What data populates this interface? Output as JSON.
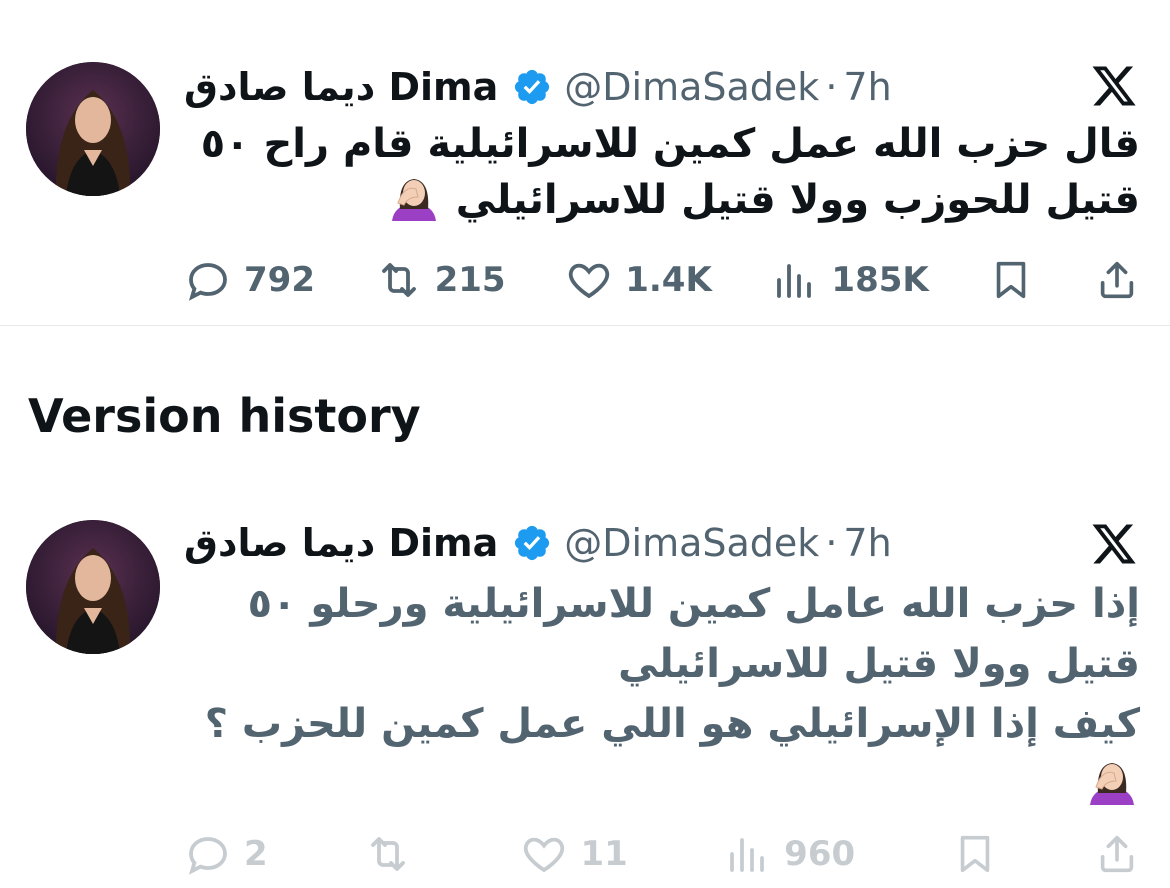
{
  "tweets": [
    {
      "name": "ديما صادق Dima",
      "handle": "@DimaSadek",
      "separator": "·",
      "time": "7h",
      "body": "قال حزب الله عمل كمين للاسرائيلية  قام راح ٥٠\nقتيل للحوزب وولا قتيل للاسرائيلي",
      "emoji": "woman-facepalming",
      "metrics": {
        "replies": "792",
        "reposts": "215",
        "likes": "1.4K",
        "views": "185K"
      }
    },
    {
      "name": "ديما صادق Dima",
      "handle": "@DimaSadek",
      "separator": "·",
      "time": "7h",
      "body": "إذا حزب الله عامل كمين للاسرائيلية ورحلو ٥٠\nقتيل وولا قتيل للاسرائيلي\nكيف إذا الإسرائيلي هو اللي عمل كمين للحزب ؟\n",
      "emoji": "woman-facepalming",
      "metrics": {
        "replies": "2",
        "reposts": "",
        "likes": "11",
        "views": "960"
      }
    }
  ],
  "section_title": "Version history",
  "colors": {
    "verified": "#1d9bf0",
    "text": "#0f1419",
    "muted": "#536471",
    "divider": "#e6e9eb"
  }
}
